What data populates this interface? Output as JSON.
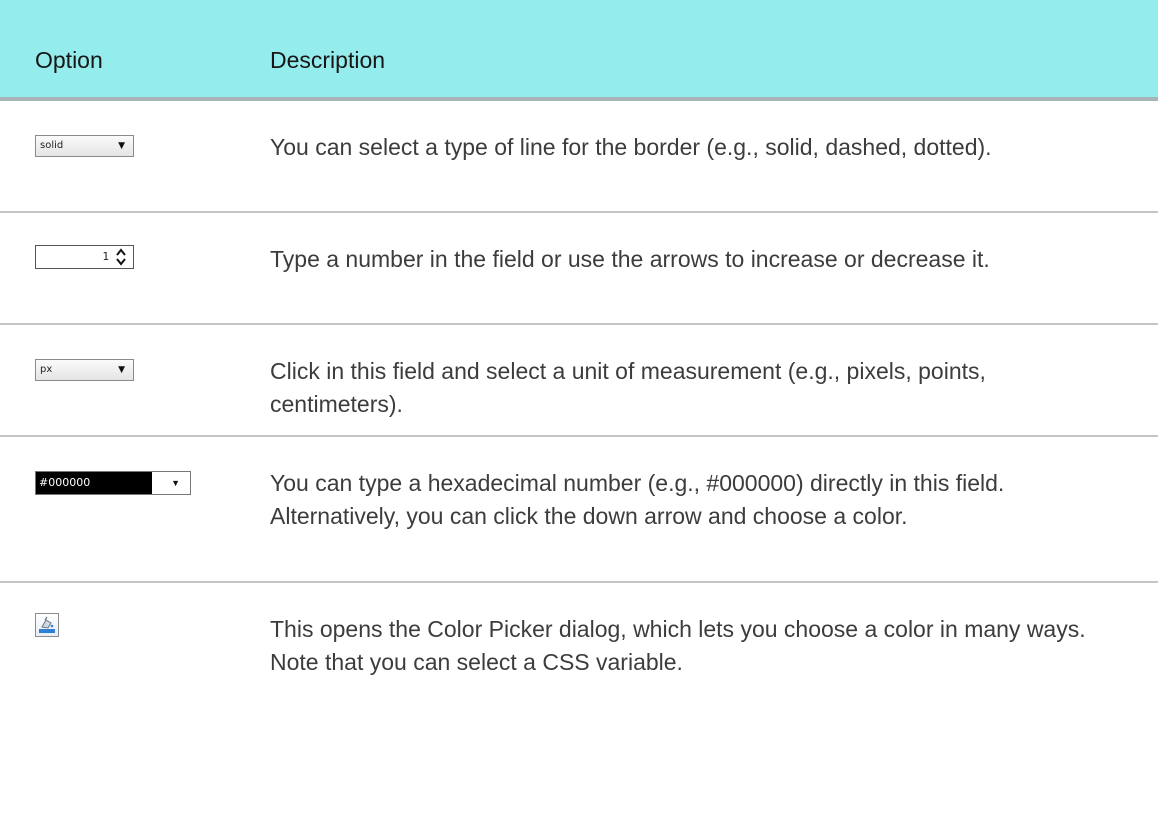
{
  "header": {
    "option_label": "Option",
    "description_label": "Description"
  },
  "rows": [
    {
      "widget": "dropdown",
      "value": "solid",
      "icon": "chevron-down-icon",
      "description": "You can select a type of line for the border (e.g., solid, dashed, dotted)."
    },
    {
      "widget": "spinner",
      "value": "1",
      "icon": "up-down-arrows-icon",
      "description": "Type a number in the field or use the arrows to increase or decrease it."
    },
    {
      "widget": "dropdown",
      "value": "px",
      "icon": "chevron-down-icon",
      "description": "Click in this field and select a unit of measurement (e.g., pixels, points, centimeters)."
    },
    {
      "widget": "color-field",
      "value": "#000000",
      "icon": "chevron-down-icon",
      "description": "You can type a hexadecimal number (e.g., #000000) directly in this field. Alternatively, you can click the down arrow and choose a color."
    },
    {
      "widget": "color-picker-button",
      "icon": "paint-bucket-icon",
      "description": "This opens the Color Picker dialog, which lets you choose a color in many ways. Note that you can select a CSS variable."
    }
  ],
  "colors": {
    "header_bg": "#94ecec",
    "header_rule": "#a9b4b6",
    "row_rule": "#c5c5c5",
    "body_text": "#3c3c3c"
  }
}
